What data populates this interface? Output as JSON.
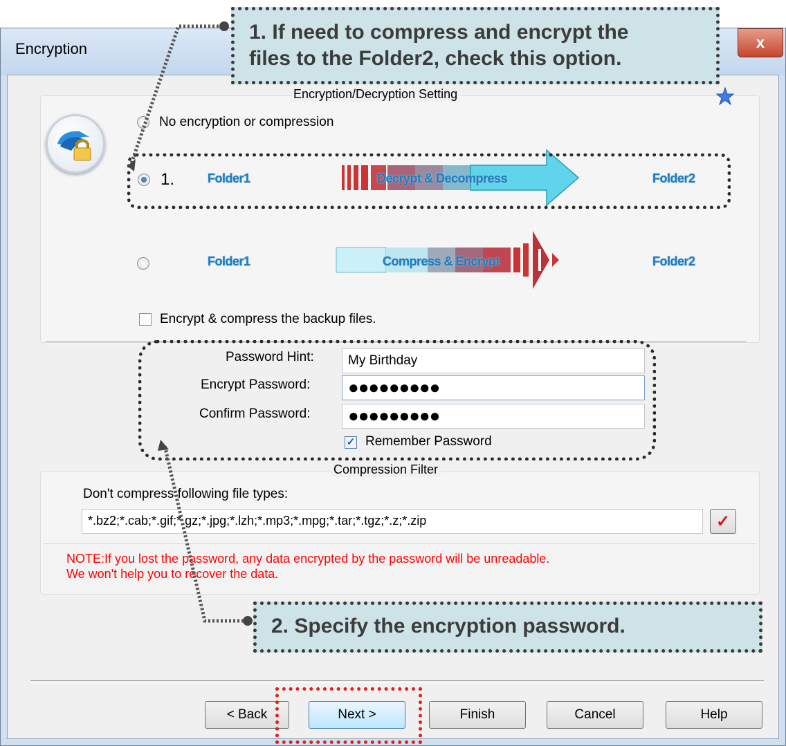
{
  "window": {
    "title": "Encryption",
    "close_glyph": "x"
  },
  "encryption_group": {
    "legend": "Encryption/Decryption Setting",
    "option_none_label": "No encryption or compression",
    "option_decrypt": {
      "prefix": "1.",
      "source": "Folder1",
      "arrow_label": "Decrypt & Decompress",
      "target": "Folder2",
      "selected": true
    },
    "option_encrypt": {
      "source": "Folder1",
      "arrow_label": "Compress & Encrypt",
      "target": "Folder2",
      "selected": false
    },
    "backup_checkbox_label": "Encrypt & compress the backup files.",
    "backup_checked": false
  },
  "password": {
    "hint_label": "Password Hint:",
    "hint_value": "My Birthday",
    "encrypt_label": "Encrypt Password:",
    "encrypt_value": "●●●●●●●●●",
    "confirm_label": "Confirm Password:",
    "confirm_value": "●●●●●●●●●",
    "remember_label": "Remember Password",
    "remember_checked": true
  },
  "compression_group": {
    "legend": "Compression Filter",
    "instructions": "Don't compress following file types:",
    "file_types": "*.bz2;*.cab;*.gif;*.gz;*.jpg;*.lzh;*.mp3;*.mpg;*.tar;*.tgz;*.z;*.zip",
    "apply_glyph": "✓"
  },
  "note": {
    "line1": "NOTE:If you lost the password, any data encrypted by the password will be unreadable.",
    "line2": "We won't help you to recover the data."
  },
  "buttons": {
    "back": "< Back",
    "next": "Next >",
    "finish": "Finish",
    "cancel": "Cancel",
    "help": "Help"
  },
  "annotations": {
    "callout1_line1": "1. If need to compress and encrypt the",
    "callout1_line2": "files to the Folder2, check this option.",
    "callout2": "2. Specify the encryption password."
  },
  "colors": {
    "note_red": "#ff0000",
    "callout_fill": "#cde3e8",
    "next_highlight": "#e3201b",
    "folder_blue": "#1c7ec2"
  },
  "icons": {
    "wizard": "lock-folder-icon",
    "star": "star-icon",
    "apply": "checkmark-icon"
  }
}
